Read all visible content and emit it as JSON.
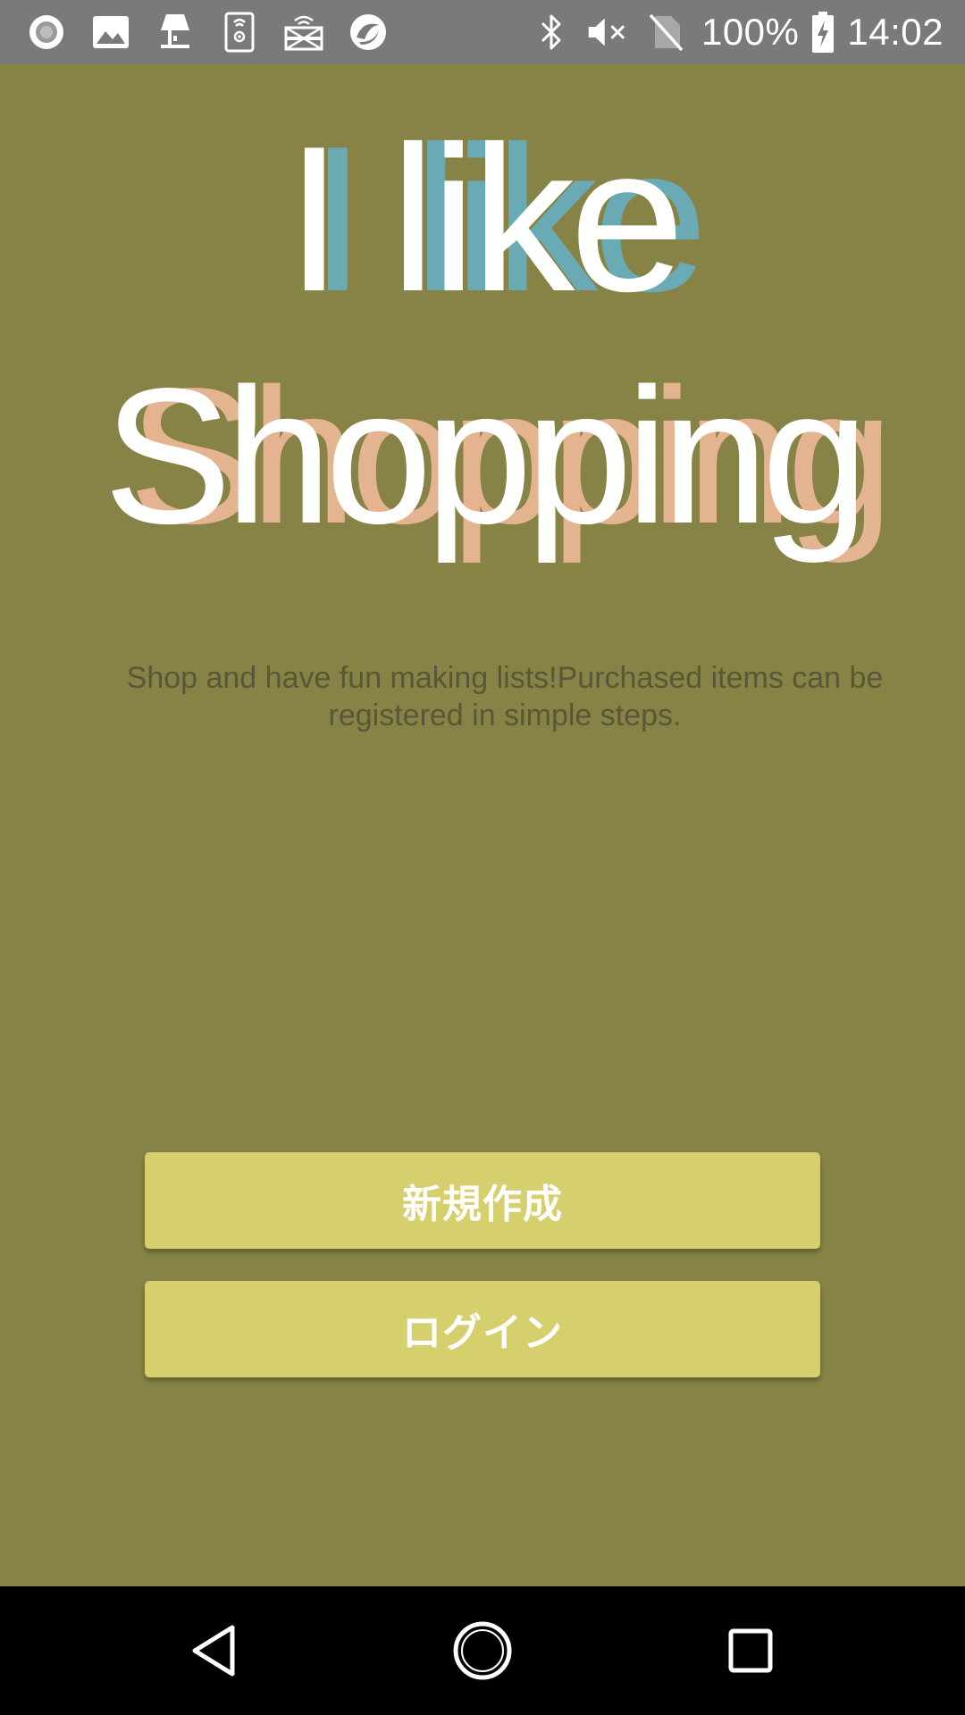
{
  "status_bar": {
    "left_icons": [
      "record-icon",
      "image-icon",
      "lamp-icon",
      "phone-settings-icon",
      "wifi-router-icon",
      "sync-app-icon"
    ],
    "right_icons": [
      "bluetooth-icon",
      "muted-volume-icon",
      "no-sim-icon",
      "battery-charging-icon"
    ],
    "battery_percent": "100%",
    "time": "14:02"
  },
  "app": {
    "logo": {
      "line1": "I like",
      "line2": "Shopping"
    },
    "tagline": "Shop and have fun making lists!Purchased items can be registered in simple steps.",
    "buttons": {
      "register_label": "新規作成",
      "login_label": "ログイン"
    }
  },
  "nav_bar": {
    "icons": [
      "back-icon",
      "home-icon",
      "recent-apps-icon"
    ]
  },
  "colors": {
    "background": "#878245",
    "status_bar": "#7a7a7a",
    "button": "#d6cf6d",
    "logo_front": "#ffffff",
    "logo_shadow_line1": "#6aaab4",
    "logo_shadow_line2": "#e4b490",
    "tagline_text": "#585838"
  }
}
